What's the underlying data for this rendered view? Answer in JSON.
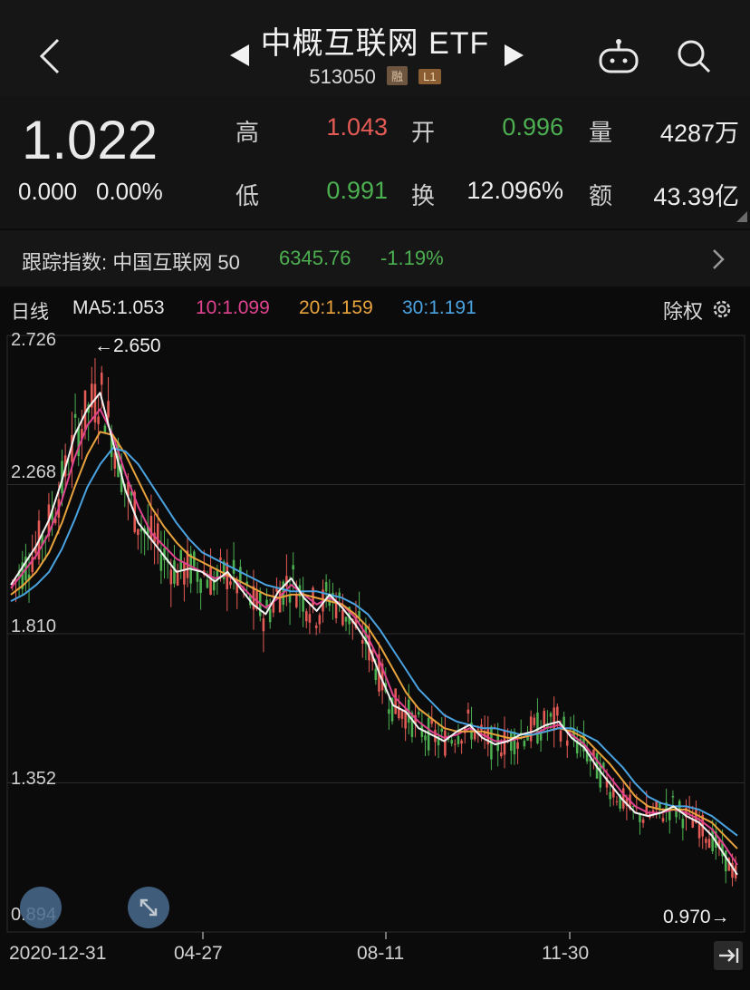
{
  "header": {
    "title": "中概互联网 ETF",
    "code": "513050",
    "tag_margin": "融",
    "tag_level": "L1"
  },
  "quote": {
    "price": "1.022",
    "change": "0.000",
    "change_pct": "0.00%",
    "high_label": "高",
    "high": "1.043",
    "open_label": "开",
    "open": "0.996",
    "volume_label": "量",
    "volume": "4287万",
    "low_label": "低",
    "low": "0.991",
    "turnover_label": "换",
    "turnover": "12.096%",
    "amount_label": "额",
    "amount": "43.39亿"
  },
  "tracking": {
    "label": "跟踪指数: 中国互联网 50",
    "value": "6345.76",
    "pct": "-1.19%"
  },
  "chart_header": {
    "period": "日线",
    "ma5": "MA5:1.053",
    "ma10": "10:1.099",
    "ma20": "20:1.159",
    "ma30": "30:1.191",
    "adjust": "除权"
  },
  "colors": {
    "up": "#e45b55",
    "down": "#4caf50",
    "ma5": "#f2f2f2",
    "ma10": "#e0438f",
    "ma20": "#e8a33c",
    "ma30": "#4aa3e0"
  },
  "chart_data": {
    "type": "line",
    "ylim": [
      0.894,
      2.726
    ],
    "y_ticks": [
      "2.726",
      "2.268",
      "1.810",
      "1.352",
      "0.894"
    ],
    "x_ticks": [
      "2020-12-31",
      "04-27",
      "08-11",
      "11-30"
    ],
    "annotations": {
      "max": "←2.650",
      "min": "0.970→"
    },
    "series": [
      {
        "name": "10",
        "values": [
          1.95,
          2.0,
          2.05,
          2.12,
          2.22,
          2.35,
          2.45,
          2.5,
          2.42,
          2.3,
          2.2,
          2.12,
          2.08,
          2.04,
          2.02,
          2.0,
          1.98,
          1.99,
          1.96,
          1.92,
          1.89,
          1.92,
          1.96,
          1.93,
          1.9,
          1.92,
          1.9,
          1.86,
          1.8,
          1.72,
          1.62,
          1.58,
          1.54,
          1.51,
          1.49,
          1.5,
          1.52,
          1.5,
          1.48,
          1.48,
          1.49,
          1.5,
          1.52,
          1.53,
          1.5,
          1.47,
          1.42,
          1.37,
          1.32,
          1.28,
          1.26,
          1.26,
          1.27,
          1.26,
          1.24,
          1.21,
          1.16,
          1.1
        ]
      },
      {
        "name": "20",
        "values": [
          1.93,
          1.96,
          2.0,
          2.06,
          2.15,
          2.26,
          2.36,
          2.43,
          2.42,
          2.36,
          2.28,
          2.2,
          2.14,
          2.09,
          2.05,
          2.03,
          2.01,
          1.99,
          1.97,
          1.95,
          1.93,
          1.92,
          1.93,
          1.93,
          1.92,
          1.91,
          1.9,
          1.87,
          1.83,
          1.77,
          1.7,
          1.63,
          1.58,
          1.55,
          1.52,
          1.51,
          1.51,
          1.51,
          1.5,
          1.49,
          1.49,
          1.5,
          1.51,
          1.52,
          1.51,
          1.49,
          1.45,
          1.41,
          1.36,
          1.31,
          1.28,
          1.27,
          1.27,
          1.27,
          1.25,
          1.23,
          1.19,
          1.15
        ]
      },
      {
        "name": "30",
        "values": [
          1.91,
          1.93,
          1.96,
          2.0,
          2.07,
          2.16,
          2.26,
          2.33,
          2.38,
          2.37,
          2.33,
          2.27,
          2.21,
          2.15,
          2.1,
          2.06,
          2.04,
          2.02,
          2.0,
          1.98,
          1.96,
          1.95,
          1.94,
          1.94,
          1.94,
          1.93,
          1.92,
          1.9,
          1.87,
          1.82,
          1.76,
          1.7,
          1.64,
          1.6,
          1.56,
          1.54,
          1.53,
          1.52,
          1.52,
          1.51,
          1.5,
          1.5,
          1.51,
          1.52,
          1.52,
          1.5,
          1.48,
          1.44,
          1.4,
          1.35,
          1.31,
          1.29,
          1.28,
          1.28,
          1.27,
          1.25,
          1.22,
          1.19
        ]
      },
      {
        "name": "MA5",
        "values": [
          1.96,
          2.02,
          2.08,
          2.16,
          2.28,
          2.42,
          2.5,
          2.55,
          2.4,
          2.25,
          2.15,
          2.1,
          2.05,
          2.0,
          2.01,
          2.0,
          1.97,
          2.0,
          1.95,
          1.9,
          1.87,
          1.94,
          1.98,
          1.92,
          1.88,
          1.93,
          1.89,
          1.84,
          1.78,
          1.68,
          1.59,
          1.57,
          1.52,
          1.5,
          1.48,
          1.51,
          1.53,
          1.49,
          1.47,
          1.48,
          1.5,
          1.51,
          1.53,
          1.54,
          1.49,
          1.46,
          1.4,
          1.35,
          1.3,
          1.26,
          1.25,
          1.26,
          1.28,
          1.25,
          1.23,
          1.19,
          1.13,
          1.07
        ]
      }
    ]
  }
}
